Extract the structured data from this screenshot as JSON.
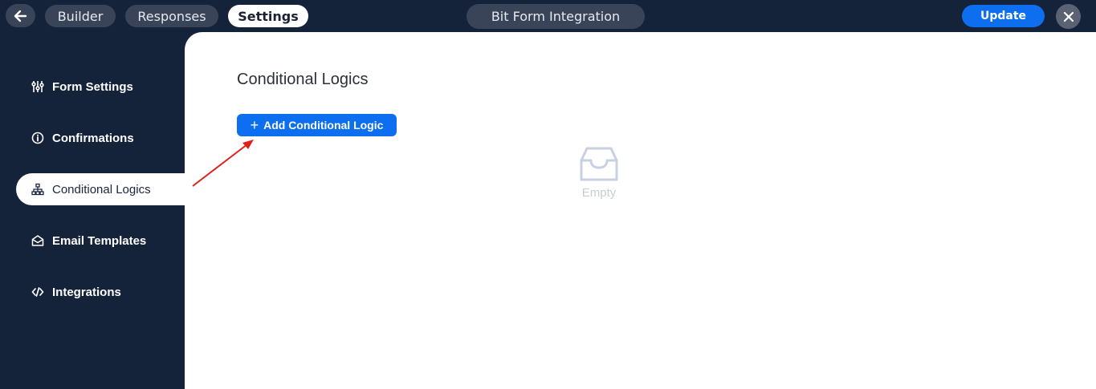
{
  "topbar": {
    "tabs": [
      {
        "label": "Builder"
      },
      {
        "label": "Responses"
      },
      {
        "label": "Settings"
      }
    ],
    "form_title": "Bit Form Integration",
    "update_label": "Update"
  },
  "sidebar": {
    "items": [
      {
        "label": "Form Settings",
        "icon": "sliders-icon"
      },
      {
        "label": "Confirmations",
        "icon": "info-icon"
      },
      {
        "label": "Conditional Logics",
        "icon": "hierarchy-icon",
        "active": true
      },
      {
        "label": "Email Templates",
        "icon": "envelope-open-icon"
      },
      {
        "label": "Integrations",
        "icon": "code-icon"
      }
    ]
  },
  "main": {
    "title": "Conditional Logics",
    "add_button_label": "Add Conditional Logic",
    "empty_label": "Empty"
  },
  "colors": {
    "sidebar_bg": "#14223a",
    "accent": "#0e6ef0",
    "annotation_arrow": "#e0201c"
  }
}
